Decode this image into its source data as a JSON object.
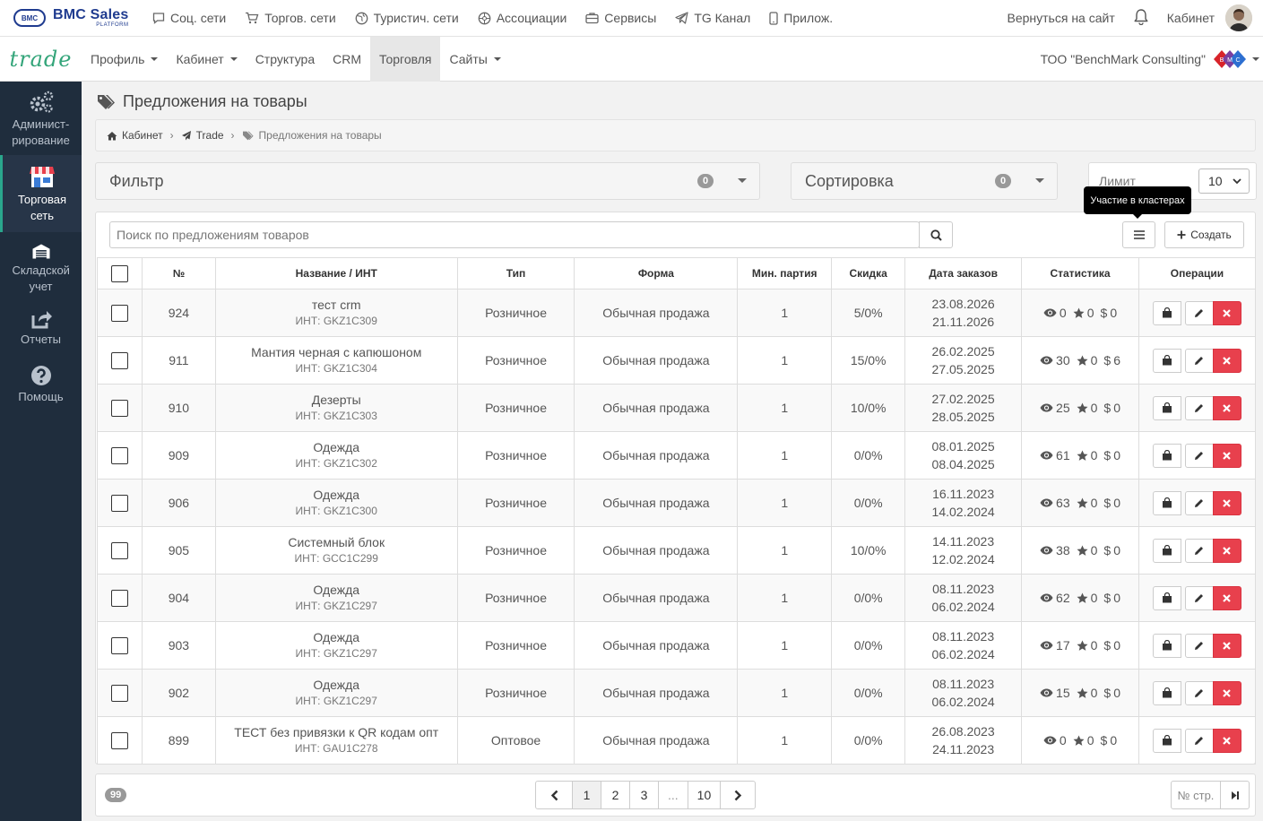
{
  "topbar": {
    "logo_badge": "BMC",
    "logo_text": "BMC Sales",
    "logo_sub": "PLATFORM",
    "nav": [
      {
        "label": "Соц. сети",
        "icon": "chat-icon"
      },
      {
        "label": "Торгов. сети",
        "icon": "cart-icon"
      },
      {
        "label": "Туристич. сети",
        "icon": "globe-icon"
      },
      {
        "label": "Ассоциации",
        "icon": "network-icon"
      },
      {
        "label": "Сервисы",
        "icon": "briefcase-icon"
      },
      {
        "label": "TG Канал",
        "icon": "telegram-icon"
      },
      {
        "label": "Прилож.",
        "icon": "phone-icon"
      }
    ],
    "back_label": "Вернуться на сайт",
    "cabinet_label": "Кабинет"
  },
  "nav2": {
    "brand": "trade",
    "items": [
      {
        "label": "Профиль",
        "dropdown": true
      },
      {
        "label": "Кабинет",
        "dropdown": true
      },
      {
        "label": "Структура",
        "dropdown": false
      },
      {
        "label": "CRM",
        "dropdown": false
      },
      {
        "label": "Торговля",
        "dropdown": false,
        "active": true
      },
      {
        "label": "Сайты",
        "dropdown": true
      }
    ],
    "company": "ТОО \"BenchMark Consulting\""
  },
  "sidebar": {
    "items": [
      {
        "label": "Админист-рирование",
        "icon": "gears-icon"
      },
      {
        "label": "Торговая сеть",
        "icon": "store-icon",
        "active": true
      },
      {
        "label": "Складской учет",
        "icon": "warehouse-icon"
      },
      {
        "label": "Отчеты",
        "icon": "share-icon"
      },
      {
        "label": "Помощь",
        "icon": "help-icon"
      }
    ]
  },
  "page": {
    "title": "Предложения на товары",
    "breadcrumb": [
      "Кабинет",
      "Trade",
      "Предложения на товары"
    ],
    "filter_label": "Фильтр",
    "filter_count": "0",
    "sort_label": "Сортировка",
    "sort_count": "0",
    "limit_label": "Лимит",
    "limit_value": "10",
    "tooltip": "Участие в кластерах",
    "search_placeholder": "Поиск по предложениям товаров",
    "create_label": "Создать"
  },
  "table": {
    "headers": [
      "№",
      "Название / ИНТ",
      "Тип",
      "Форма",
      "Мин. партия",
      "Скидка",
      "Дата заказов",
      "Статистика",
      "Операции"
    ],
    "rows": [
      {
        "id": "924",
        "name": "тест crm",
        "int": "ИНТ: GKZ1C309",
        "type": "Розничное",
        "form": "Обычная продажа",
        "min": "1",
        "discount": "5/0%",
        "date1": "23.08.2026",
        "date2": "21.11.2026",
        "views": "0",
        "stars": "0",
        "money": "0"
      },
      {
        "id": "911",
        "name": "Мантия черная с капюшоном",
        "int": "ИНТ: GKZ1C304",
        "type": "Розничное",
        "form": "Обычная продажа",
        "min": "1",
        "discount": "15/0%",
        "date1": "26.02.2025",
        "date2": "27.05.2025",
        "views": "30",
        "stars": "0",
        "money": "6"
      },
      {
        "id": "910",
        "name": "Дезерты",
        "int": "ИНТ: GKZ1C303",
        "type": "Розничное",
        "form": "Обычная продажа",
        "min": "1",
        "discount": "10/0%",
        "date1": "27.02.2025",
        "date2": "28.05.2025",
        "views": "25",
        "stars": "0",
        "money": "0"
      },
      {
        "id": "909",
        "name": "Одежда",
        "int": "ИНТ: GKZ1C302",
        "type": "Розничное",
        "form": "Обычная продажа",
        "min": "1",
        "discount": "0/0%",
        "date1": "08.01.2025",
        "date2": "08.04.2025",
        "views": "61",
        "stars": "0",
        "money": "0"
      },
      {
        "id": "906",
        "name": "Одежда",
        "int": "ИНТ: GKZ1C300",
        "type": "Розничное",
        "form": "Обычная продажа",
        "min": "1",
        "discount": "0/0%",
        "date1": "16.11.2023",
        "date2": "14.02.2024",
        "views": "63",
        "stars": "0",
        "money": "0"
      },
      {
        "id": "905",
        "name": "Системный блок",
        "int": "ИНТ: GCC1C299",
        "type": "Розничное",
        "form": "Обычная продажа",
        "min": "1",
        "discount": "10/0%",
        "date1": "14.11.2023",
        "date2": "12.02.2024",
        "views": "38",
        "stars": "0",
        "money": "0"
      },
      {
        "id": "904",
        "name": "Одежда",
        "int": "ИНТ: GKZ1C297",
        "type": "Розничное",
        "form": "Обычная продажа",
        "min": "1",
        "discount": "0/0%",
        "date1": "08.11.2023",
        "date2": "06.02.2024",
        "views": "62",
        "stars": "0",
        "money": "0"
      },
      {
        "id": "903",
        "name": "Одежда",
        "int": "ИНТ: GKZ1C297",
        "type": "Розничное",
        "form": "Обычная продажа",
        "min": "1",
        "discount": "0/0%",
        "date1": "08.11.2023",
        "date2": "06.02.2024",
        "views": "17",
        "stars": "0",
        "money": "0"
      },
      {
        "id": "902",
        "name": "Одежда",
        "int": "ИНТ: GKZ1C297",
        "type": "Розничное",
        "form": "Обычная продажа",
        "min": "1",
        "discount": "0/0%",
        "date1": "08.11.2023",
        "date2": "06.02.2024",
        "views": "15",
        "stars": "0",
        "money": "0"
      },
      {
        "id": "899",
        "name": "ТЕСТ без привязки к QR кодам опт",
        "int": "ИНТ: GAU1C278",
        "type": "Оптовое",
        "form": "Обычная продажа",
        "min": "1",
        "discount": "0/0%",
        "date1": "26.08.2023",
        "date2": "24.11.2023",
        "views": "0",
        "stars": "0",
        "money": "0"
      }
    ]
  },
  "footer": {
    "total": "99",
    "pages": [
      "1",
      "2",
      "3",
      "...",
      "10"
    ],
    "current_page": "1",
    "page_input_placeholder": "№ стр."
  },
  "colors": {
    "accent": "#34a57a",
    "sidebar": "#1f2d3d",
    "danger": "#e8404d"
  }
}
